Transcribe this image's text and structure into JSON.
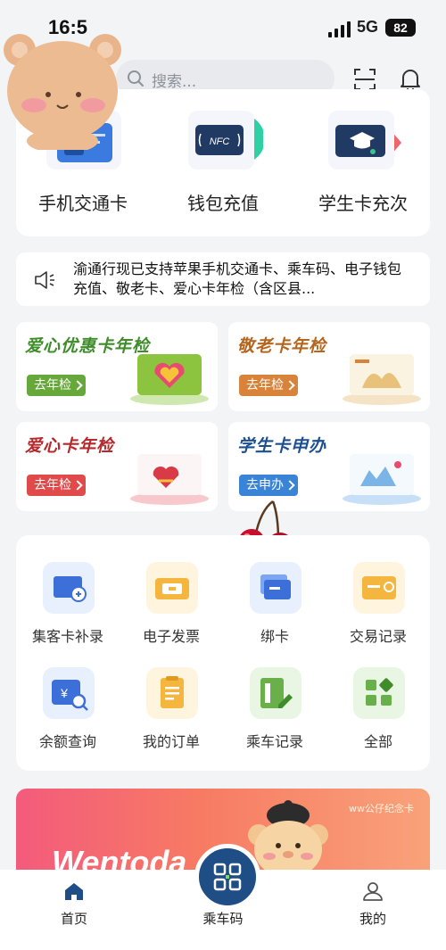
{
  "status_bar": {
    "time": "16:5",
    "network": "5G",
    "battery": "82"
  },
  "header": {
    "search_placeholder": "搜索..."
  },
  "quick_actions": [
    {
      "label": "手机交通卡",
      "icon": "phone-transit-card-icon"
    },
    {
      "label": "钱包充值",
      "icon": "nfc-wallet-icon"
    },
    {
      "label": "学生卡充次",
      "icon": "student-card-icon"
    }
  ],
  "notice": {
    "text": "渝通行现已支持苹果手机交通卡、乘车码、电子钱包充值、敬老卡、爱心卡年检（含区县..."
  },
  "promos": [
    {
      "title": "爱心优惠卡年检",
      "button": "去年检",
      "title_color": "#3f8d2a",
      "button_color": "#67a83a"
    },
    {
      "title": "敬老卡年检",
      "button": "去年检",
      "title_color": "#b5651d",
      "button_color": "#d9823a"
    },
    {
      "title": "爱心卡年检",
      "button": "去年检",
      "title_color": "#b5282b",
      "button_color": "#e04a4a"
    },
    {
      "title": "学生卡申办",
      "button": "去申办",
      "title_color": "#1c4f8f",
      "button_color": "#3a84d8"
    }
  ],
  "services": [
    {
      "label": "集客卡补录",
      "icon": "card-add-icon"
    },
    {
      "label": "电子发票",
      "icon": "invoice-icon"
    },
    {
      "label": "绑卡",
      "icon": "bind-card-icon"
    },
    {
      "label": "交易记录",
      "icon": "transaction-record-icon"
    },
    {
      "label": "余额查询",
      "icon": "balance-query-icon"
    },
    {
      "label": "我的订单",
      "icon": "my-orders-icon"
    },
    {
      "label": "乘车记录",
      "icon": "ride-record-icon"
    },
    {
      "label": "全部",
      "icon": "all-apps-icon"
    }
  ],
  "banner": {
    "text": "Wentoda",
    "small_text": "ww公仔纪念卡"
  },
  "tabbar": {
    "home": "首页",
    "ride_code": "乘车码",
    "mine": "我的"
  },
  "colors": {
    "accent": "#1f4e86",
    "background": "#f3f4f6"
  }
}
